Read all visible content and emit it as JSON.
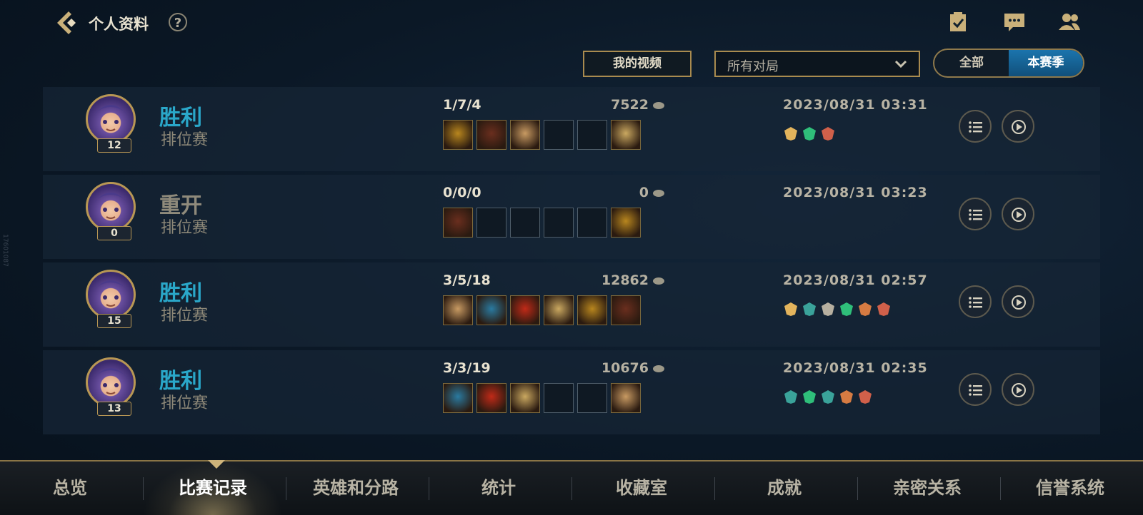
{
  "header": {
    "title": "个人资料",
    "help_label": "?",
    "icons": [
      "missions-icon",
      "chat-icon",
      "friends-icon"
    ]
  },
  "filters": {
    "video_button": "我的视频",
    "match_type": "所有对局",
    "toggle": {
      "all": "全部",
      "season": "本赛季",
      "selected": "本赛季"
    }
  },
  "matches": [
    {
      "result": "胜利",
      "result_color": "#2aa7c9",
      "mode": "排位赛",
      "level": "12",
      "kda": "1/7/4",
      "gold": "7522",
      "date": "2023/08/31 03:31",
      "items_filled": [
        true,
        true,
        true,
        false,
        false,
        true
      ],
      "badges": [
        "dragon-badge",
        "heal-badge",
        "beast-badge"
      ]
    },
    {
      "result": "重开",
      "result_color": "#8f8a7b",
      "mode": "排位赛",
      "level": "0",
      "kda": "0/0/0",
      "gold": "0",
      "date": "2023/08/31 03:23",
      "items_filled": [
        true,
        false,
        false,
        false,
        false,
        true
      ],
      "badges": []
    },
    {
      "result": "胜利",
      "result_color": "#2aa7c9",
      "mode": "排位赛",
      "level": "15",
      "kda": "3/5/18",
      "gold": "12862",
      "date": "2023/08/31 02:57",
      "items_filled": [
        true,
        true,
        true,
        true,
        true,
        true
      ],
      "badges": [
        "dragon-badge",
        "shield-badge",
        "link-badge",
        "heal-badge",
        "chain-badge",
        "beast-badge"
      ]
    },
    {
      "result": "胜利",
      "result_color": "#2aa7c9",
      "mode": "排位赛",
      "level": "13",
      "kda": "3/3/19",
      "gold": "10676",
      "date": "2023/08/31 02:35",
      "items_filled": [
        true,
        true,
        true,
        false,
        false,
        true
      ],
      "badges": [
        "shield-badge",
        "heal-badge",
        "shield2-badge",
        "chain-badge",
        "beast-badge"
      ]
    }
  ],
  "tabs": [
    "总览",
    "比赛记录",
    "英雄和分路",
    "统计",
    "收藏室",
    "成就",
    "亲密关系",
    "信誉系统"
  ],
  "active_tab": "比赛记录",
  "watermark": "17601087",
  "colors": {
    "gold_border": "#a98b4f",
    "win_blue": "#2aa7c9",
    "toggle_active": "#1b74ad"
  }
}
